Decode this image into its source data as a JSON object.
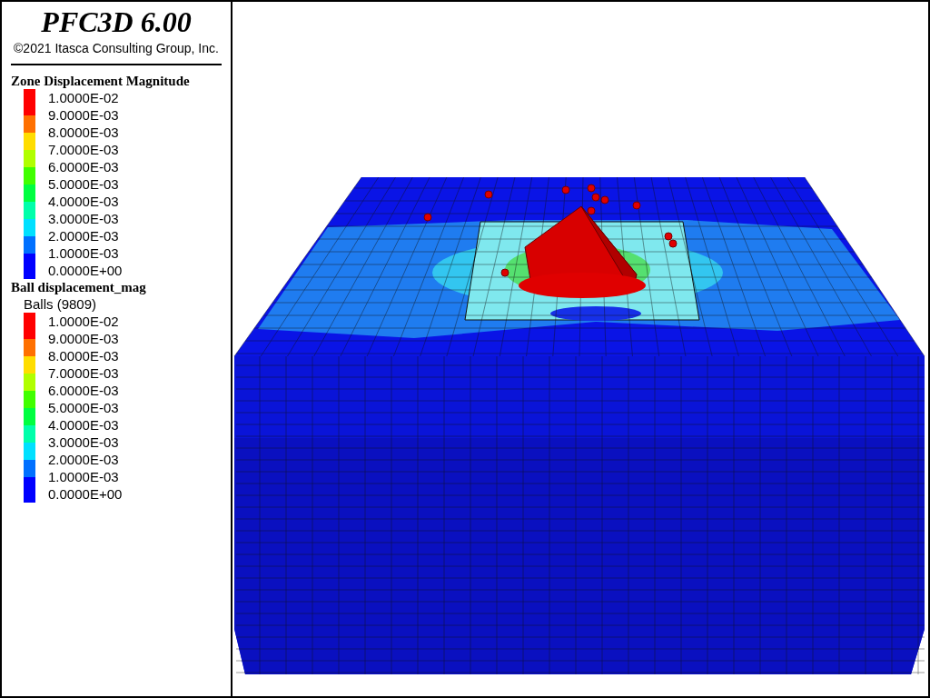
{
  "header": {
    "title": "PFC3D 6.00",
    "copyright": "©2021 Itasca Consulting Group, Inc."
  },
  "legends": [
    {
      "title": "Zone Displacement Magnitude",
      "labels": [
        "1.0000E-02",
        "9.0000E-03",
        "8.0000E-03",
        "7.0000E-03",
        "6.0000E-03",
        "5.0000E-03",
        "4.0000E-03",
        "3.0000E-03",
        "2.0000E-03",
        "1.0000E-03",
        "0.0000E+00"
      ],
      "bands": [
        {
          "color": "#ff0000"
        },
        {
          "color": "#ff7000"
        },
        {
          "color": "#ffdd00"
        },
        {
          "color": "#b0ff00"
        },
        {
          "color": "#40ff00"
        },
        {
          "color": "#00ff40"
        },
        {
          "color": "#00ffaa"
        },
        {
          "color": "#00e0ff"
        },
        {
          "color": "#0070ff"
        },
        {
          "color": "#0000ff"
        }
      ]
    },
    {
      "title": "Ball displacement_mag",
      "subtitle": "Balls (9809)",
      "labels": [
        "1.0000E-02",
        "9.0000E-03",
        "8.0000E-03",
        "7.0000E-03",
        "6.0000E-03",
        "5.0000E-03",
        "4.0000E-03",
        "3.0000E-03",
        "2.0000E-03",
        "1.0000E-03",
        "0.0000E+00"
      ],
      "bands": [
        {
          "color": "#ff0000"
        },
        {
          "color": "#ff7000"
        },
        {
          "color": "#ffdd00"
        },
        {
          "color": "#b0ff00"
        },
        {
          "color": "#40ff00"
        },
        {
          "color": "#00ff40"
        },
        {
          "color": "#00ffaa"
        },
        {
          "color": "#00e0ff"
        },
        {
          "color": "#0070ff"
        },
        {
          "color": "#0000ff"
        }
      ]
    }
  ]
}
